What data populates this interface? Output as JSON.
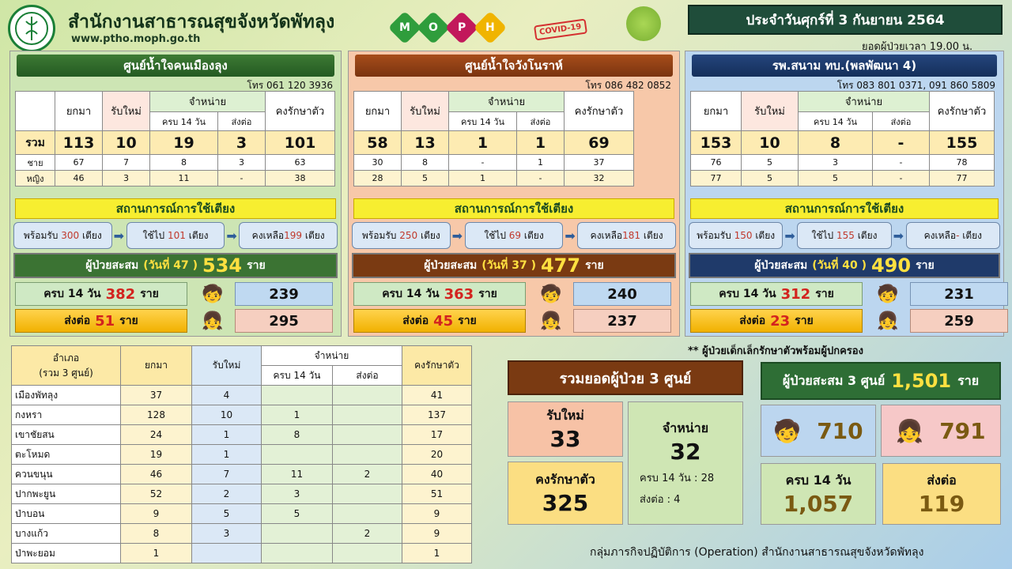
{
  "header": {
    "agency": "สำนักงานสาธารณสุขจังหวัดพัทลุง",
    "website": "www.ptho.moph.go.th",
    "moph": [
      "M",
      "O",
      "P",
      "H"
    ],
    "covid_badge": "COVID-19",
    "date": "ประจำวันศุกร์ที่ 3 กันยายน 2564",
    "time_note": "ยอดผู้ป่วยเวลา 19.00 น."
  },
  "headers": {
    "carry": "ยกมา",
    "new": "รับใหม่",
    "discharge": "จำหน่าย",
    "complete": "ครบ 14 วัน",
    "refer": "ส่งต่อ",
    "remain": "คงรักษาตัว",
    "total_row": "รวม",
    "male": "ชาย",
    "female": "หญิง",
    "bed_title": "สถานการณ์การใช้เตียง",
    "acc_label": "ผู้ป่วยสะสม",
    "acc_unit": "ราย"
  },
  "centers": [
    {
      "name": "ศูนย์น้ำใจคนเมืองลุง",
      "phone": "โทร 061 120 3936",
      "total": [
        "113",
        "10",
        "19",
        "3",
        "101"
      ],
      "male": [
        "67",
        "7",
        "8",
        "3",
        "63"
      ],
      "female": [
        "46",
        "3",
        "11",
        "-",
        "38"
      ],
      "beds": {
        "ready": "พร้อมรับ",
        "ready_n": "300",
        "used": "ใช้ไป",
        "used_n": "101",
        "left": "คงเหลือ",
        "left_n": "199",
        "unit": "เตียง"
      },
      "acc_day": "(วันที่ 47 )",
      "acc": "534",
      "complete14": "ครบ 14 วัน",
      "complete14_n": "382",
      "refer": "ส่งต่อ",
      "refer_n": "51",
      "boys": "239",
      "girls": "295"
    },
    {
      "name": "ศูนย์น้ำใจวังโนราห์",
      "phone": "โทร 086 482 0852",
      "total": [
        "58",
        "13",
        "1",
        "1",
        "69"
      ],
      "male": [
        "30",
        "8",
        "-",
        "1",
        "37"
      ],
      "female": [
        "28",
        "5",
        "1",
        "-",
        "32"
      ],
      "beds": {
        "ready": "พร้อมรับ",
        "ready_n": "250",
        "used": "ใช้ไป",
        "used_n": "69",
        "left": "คงเหลือ",
        "left_n": "181",
        "unit": "เตียง"
      },
      "acc_day": "(วันที่ 37 )",
      "acc": "477",
      "complete14": "ครบ 14 วัน",
      "complete14_n": "363",
      "refer": "ส่งต่อ",
      "refer_n": "45",
      "boys": "240",
      "girls": "237"
    },
    {
      "name": "รพ.สนาม ทบ.(พลพัฒนา 4)",
      "phone": "โทร 083 801 0371, 091 860 5809",
      "total": [
        "153",
        "10",
        "8",
        "-",
        "155"
      ],
      "male": [
        "76",
        "5",
        "3",
        "-",
        "78"
      ],
      "female": [
        "77",
        "5",
        "5",
        "-",
        "77"
      ],
      "beds": {
        "ready": "พร้อมรับ",
        "ready_n": "150",
        "used": "ใช้ไป",
        "used_n": "155",
        "left": "คงเหลือ",
        "left_n": "-",
        "unit": "เตียง"
      },
      "acc_day": "(วันที่ 40 )",
      "acc": "490",
      "complete14": "ครบ 14 วัน",
      "complete14_n": "312",
      "refer": "ส่งต่อ",
      "refer_n": "23",
      "boys": "231",
      "girls": "259"
    }
  ],
  "district_table": {
    "head_district": "อำเภอ",
    "head_sub": "(รวม 3 ศูนย์)",
    "rows": [
      [
        "เมืองพัทลุง",
        "37",
        "4",
        "",
        "",
        "41"
      ],
      [
        "กงหรา",
        "128",
        "10",
        "1",
        "",
        "137"
      ],
      [
        "เขาชัยสน",
        "24",
        "1",
        "8",
        "",
        "17"
      ],
      [
        "ตะโหมด",
        "19",
        "1",
        "",
        "",
        "20"
      ],
      [
        "ควนขนุน",
        "46",
        "7",
        "11",
        "2",
        "40"
      ],
      [
        "ปากพะยูน",
        "52",
        "2",
        "3",
        "",
        "51"
      ],
      [
        "ป่าบอน",
        "9",
        "5",
        "5",
        "",
        "9"
      ],
      [
        "บางแก้ว",
        "8",
        "3",
        "",
        "2",
        "9"
      ],
      [
        "ป่าพะยอม",
        "1",
        "",
        "",
        "",
        "1"
      ]
    ]
  },
  "summary": {
    "note": "** ผู้ป่วยเด็กเล็กรักษาตัวพร้อมผู้ปกครอง",
    "title": "รวมยอดผู้ป่วย 3 ศูนย์",
    "new_label": "รับใหม่",
    "new": "33",
    "disc_label": "จำหน่าย",
    "disc": "32",
    "disc_14": "ครบ 14 วัน  : 28",
    "disc_refer": "ส่งต่อ : 4",
    "remain_label": "คงรักษาตัว",
    "remain": "325",
    "acc_label": "ผู้ป่วยสะสม 3 ศูนย์",
    "acc": "1,501",
    "acc_unit": "ราย",
    "male": "710",
    "female": "791",
    "c14_label": "ครบ 14 วัน",
    "c14": "1,057",
    "refer_label": "ส่งต่อ",
    "refer": "119"
  },
  "footer": "กลุ่มภารกิจปฏิบัติการ (Operation) สำนักงานสาธารณสุขจังหวัดพัทลุง",
  "colors": {
    "m": "#2f9d3c",
    "o": "#2f9d3c",
    "p": "#c2185b",
    "h": "#f0b400"
  }
}
